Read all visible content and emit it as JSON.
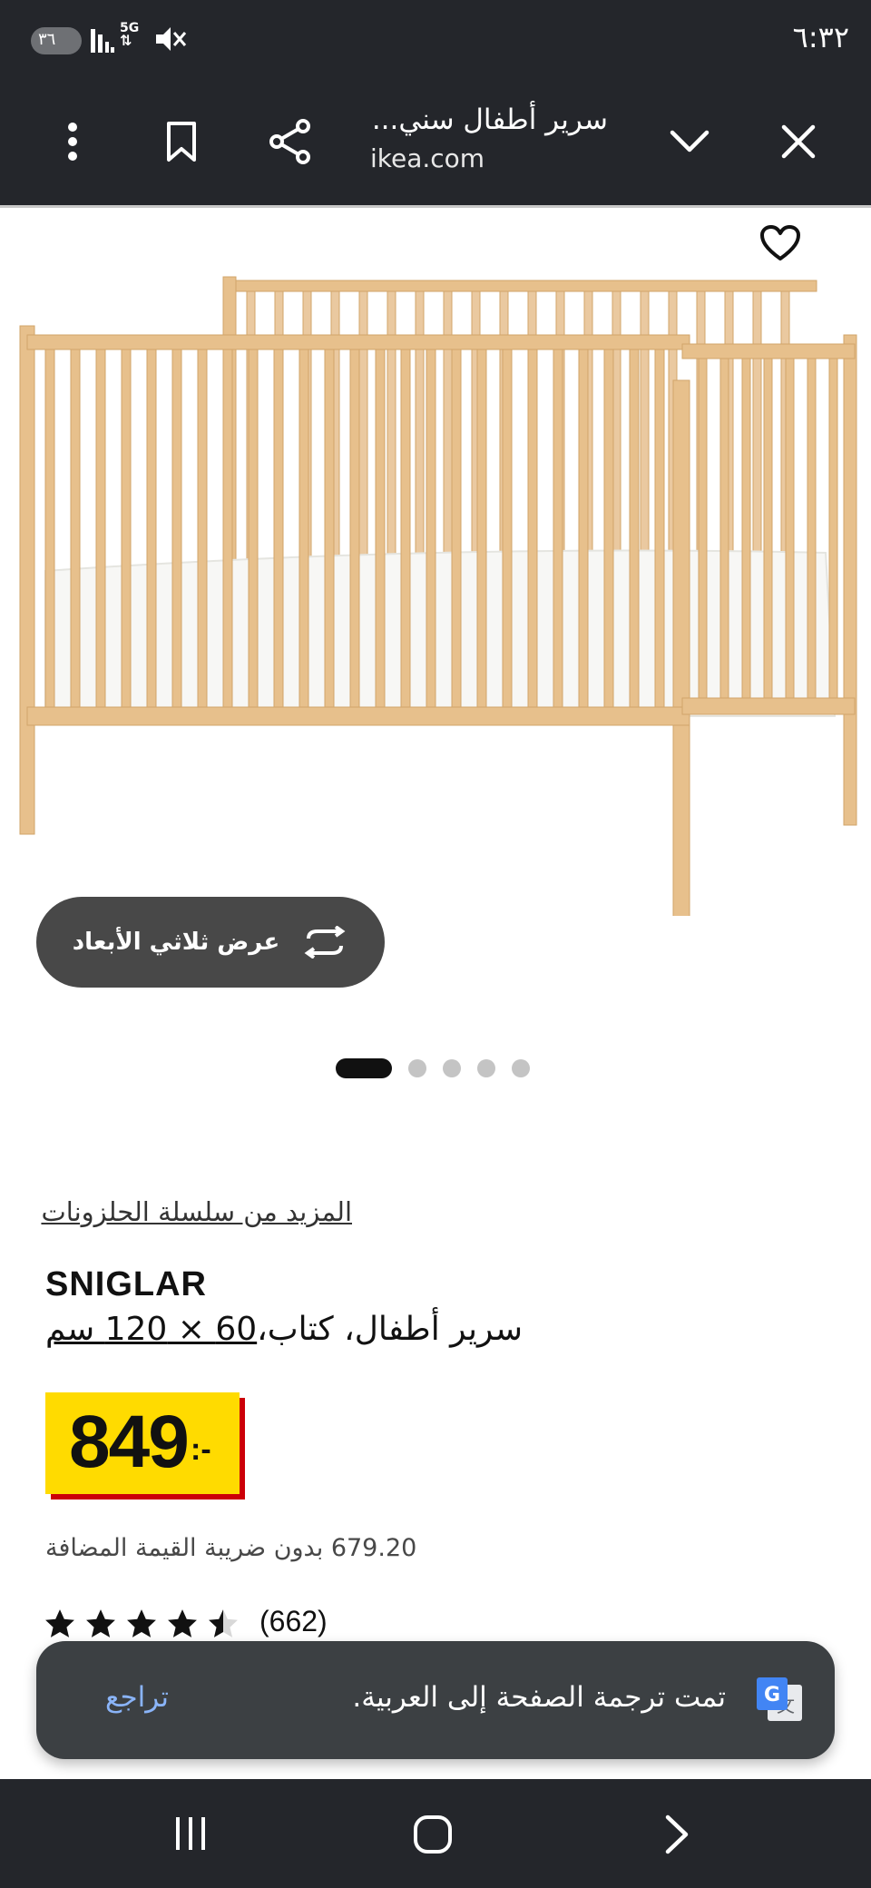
{
  "status_bar": {
    "clock": "٦:٣٢",
    "badge": "٣٦",
    "net_label": "5G"
  },
  "browser": {
    "page_title": "سرير أطفال سني...",
    "domain": "ikea.com"
  },
  "product": {
    "view3d_label": "عرض ثلاثي الأبعاد",
    "carousel": {
      "total": 5,
      "active": 1
    },
    "series_link": "المزيد من سلسلة الحلزونات",
    "name": "SNIGLAR",
    "desc_prefix": "سرير أطفال، كتاب،",
    "desc_size": "60 × 120 سم",
    "price_value": "849",
    "price_suffix": ":-",
    "price_excl_vat": "679.20 بدون ضريبة القيمة المضافة",
    "rating": {
      "stars": 4.5,
      "max": 5,
      "count": "(662)"
    }
  },
  "toast": {
    "message": "تمت ترجمة الصفحة إلى العربية.",
    "undo_label": "تراجع"
  },
  "colors": {
    "bar_bg": "#24262b",
    "price_yellow": "#ffdb00",
    "price_red": "#cc0008",
    "toast_bg": "#3c4043",
    "link_blue": "#8ab4f8"
  }
}
